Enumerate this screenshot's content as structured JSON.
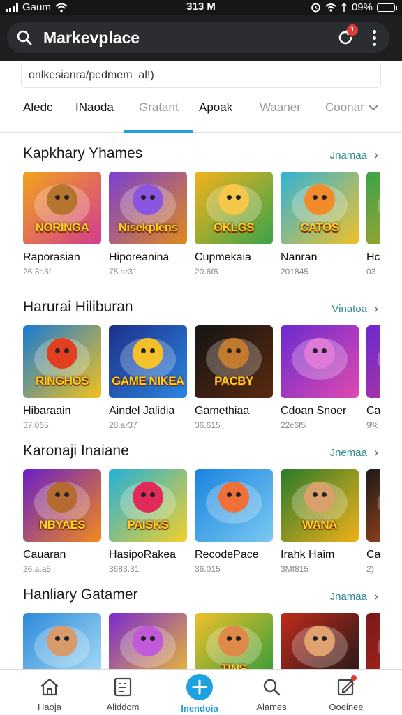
{
  "status_bar": {
    "carrier": "Gaum",
    "time": "313 M",
    "battery": "09%",
    "battery_level": 0.9
  },
  "header": {
    "title": "Markevplace",
    "notification_count": "1"
  },
  "search": {
    "value": "onlkesianra/pedmem  al!)"
  },
  "tabs": [
    {
      "label": "Aledc"
    },
    {
      "label": "INaoda"
    },
    {
      "label": "Gratant",
      "active": true
    },
    {
      "label": "Apoak"
    },
    {
      "label": "Waaner"
    },
    {
      "label": "Coonar"
    }
  ],
  "sections": [
    {
      "title": "Kapkhary Yhames",
      "more_label": "Jnamaa",
      "items": [
        {
          "name": "Raporasian",
          "meta": "26.3a3f",
          "banner": "NORINGA",
          "colors": [
            "#f2a31b",
            "#d23c8f"
          ],
          "face": "#b5752f"
        },
        {
          "name": "Hiporeanina",
          "meta": "75.ar31",
          "banner": "Nisekplens",
          "colors": [
            "#7b3fd6",
            "#e08a1a"
          ],
          "face": "#8a56e0"
        },
        {
          "name": "Cupmekaia",
          "meta": "20.6f6",
          "banner": "OKLGS",
          "colors": [
            "#f3b21a",
            "#3aa34b"
          ],
          "face": "#f5c84a"
        },
        {
          "name": "Nanran",
          "meta": "201845",
          "banner": "CATOS",
          "colors": [
            "#2fb3d8",
            "#f0c02a"
          ],
          "face": "#f28b2a"
        },
        {
          "name": "Hc",
          "meta": "03",
          "banner": "",
          "colors": [
            "#3aa34b",
            "#d8a41a"
          ],
          "face": "#9a5b2a"
        }
      ]
    },
    {
      "title": "Harurai Hiliburan",
      "more_label": "Vinatoa",
      "items": [
        {
          "name": "Hibaraain",
          "meta": "37.065",
          "banner": "RINGHOS",
          "colors": [
            "#1a7ad6",
            "#f2c21a"
          ],
          "face": "#e0401f"
        },
        {
          "name": "Aindel Jalidia",
          "meta": "28.ar37",
          "banner": "GAME NIKEA",
          "colors": [
            "#1c2f8a",
            "#2b86e0"
          ],
          "face": "#f4c12a"
        },
        {
          "name": "Gamethiaa",
          "meta": "36.615",
          "banner": "PACBY",
          "colors": [
            "#141414",
            "#5a2a10"
          ],
          "face": "#c27a2f"
        },
        {
          "name": "Cdoan Snoer",
          "meta": "22c6f5",
          "banner": "",
          "colors": [
            "#6a2ad0",
            "#e04ab0"
          ],
          "face": "#e07ad8"
        },
        {
          "name": "Ca",
          "meta": "9%",
          "banner": "",
          "colors": [
            "#6a2ad0",
            "#d03a8a"
          ],
          "face": "#f2c21a"
        }
      ]
    },
    {
      "title": "Karonaji Inaiane",
      "more_label": "Jnemaa",
      "items": [
        {
          "name": "Cauaran",
          "meta": "26.a.a5",
          "banner": "NBYAES",
          "colors": [
            "#6a1fc8",
            "#f08a1a"
          ],
          "face": "#b56b2f"
        },
        {
          "name": "HasipoRakea",
          "meta": "3683.31",
          "banner": "PAISKS",
          "colors": [
            "#22b0d8",
            "#f2d02a"
          ],
          "face": "#e02a5a"
        },
        {
          "name": "RecodePace",
          "meta": "36.015",
          "banner": "",
          "colors": [
            "#1a84e0",
            "#7ac8f0"
          ],
          "face": "#f0703a"
        },
        {
          "name": "Irahk Haim",
          "meta": "3Mf815",
          "banner": "WANA",
          "colors": [
            "#2a7a2a",
            "#f0b01a"
          ],
          "face": "#d8a06a"
        },
        {
          "name": "Ca",
          "meta": "2)",
          "banner": "",
          "colors": [
            "#1a1a1a",
            "#e05a1a"
          ],
          "face": "#d06a2a"
        }
      ]
    },
    {
      "title": "Hanliary Gatamer",
      "more_label": "Jnamaa",
      "items": [
        {
          "name": "",
          "meta": "",
          "banner": "",
          "colors": [
            "#2b8ad8",
            "#b0e0f8"
          ],
          "face": "#d89a6a"
        },
        {
          "name": "",
          "meta": "",
          "banner": "",
          "colors": [
            "#7a2ad0",
            "#f0c02a"
          ],
          "face": "#c05ad8"
        },
        {
          "name": "",
          "meta": "",
          "banner": "TINS",
          "colors": [
            "#f0c02a",
            "#2a9a3a"
          ],
          "face": "#e08a4a"
        },
        {
          "name": "",
          "meta": "",
          "banner": "",
          "colors": [
            "#c02a1a",
            "#1a1a1a"
          ],
          "face": "#e0a070"
        },
        {
          "name": "",
          "meta": "",
          "banner": "",
          "colors": [
            "#7a1a1a",
            "#c02a1a"
          ],
          "face": "#b05a2a"
        }
      ]
    }
  ],
  "bottom_nav": [
    {
      "label": "Haoja",
      "icon": "home-icon"
    },
    {
      "label": "Aliddom",
      "icon": "library-icon"
    },
    {
      "label": "Inendoia",
      "icon": "add-icon",
      "active": true
    },
    {
      "label": "Alames",
      "icon": "search-icon"
    },
    {
      "label": "Ooeinee",
      "icon": "edit-icon"
    }
  ]
}
